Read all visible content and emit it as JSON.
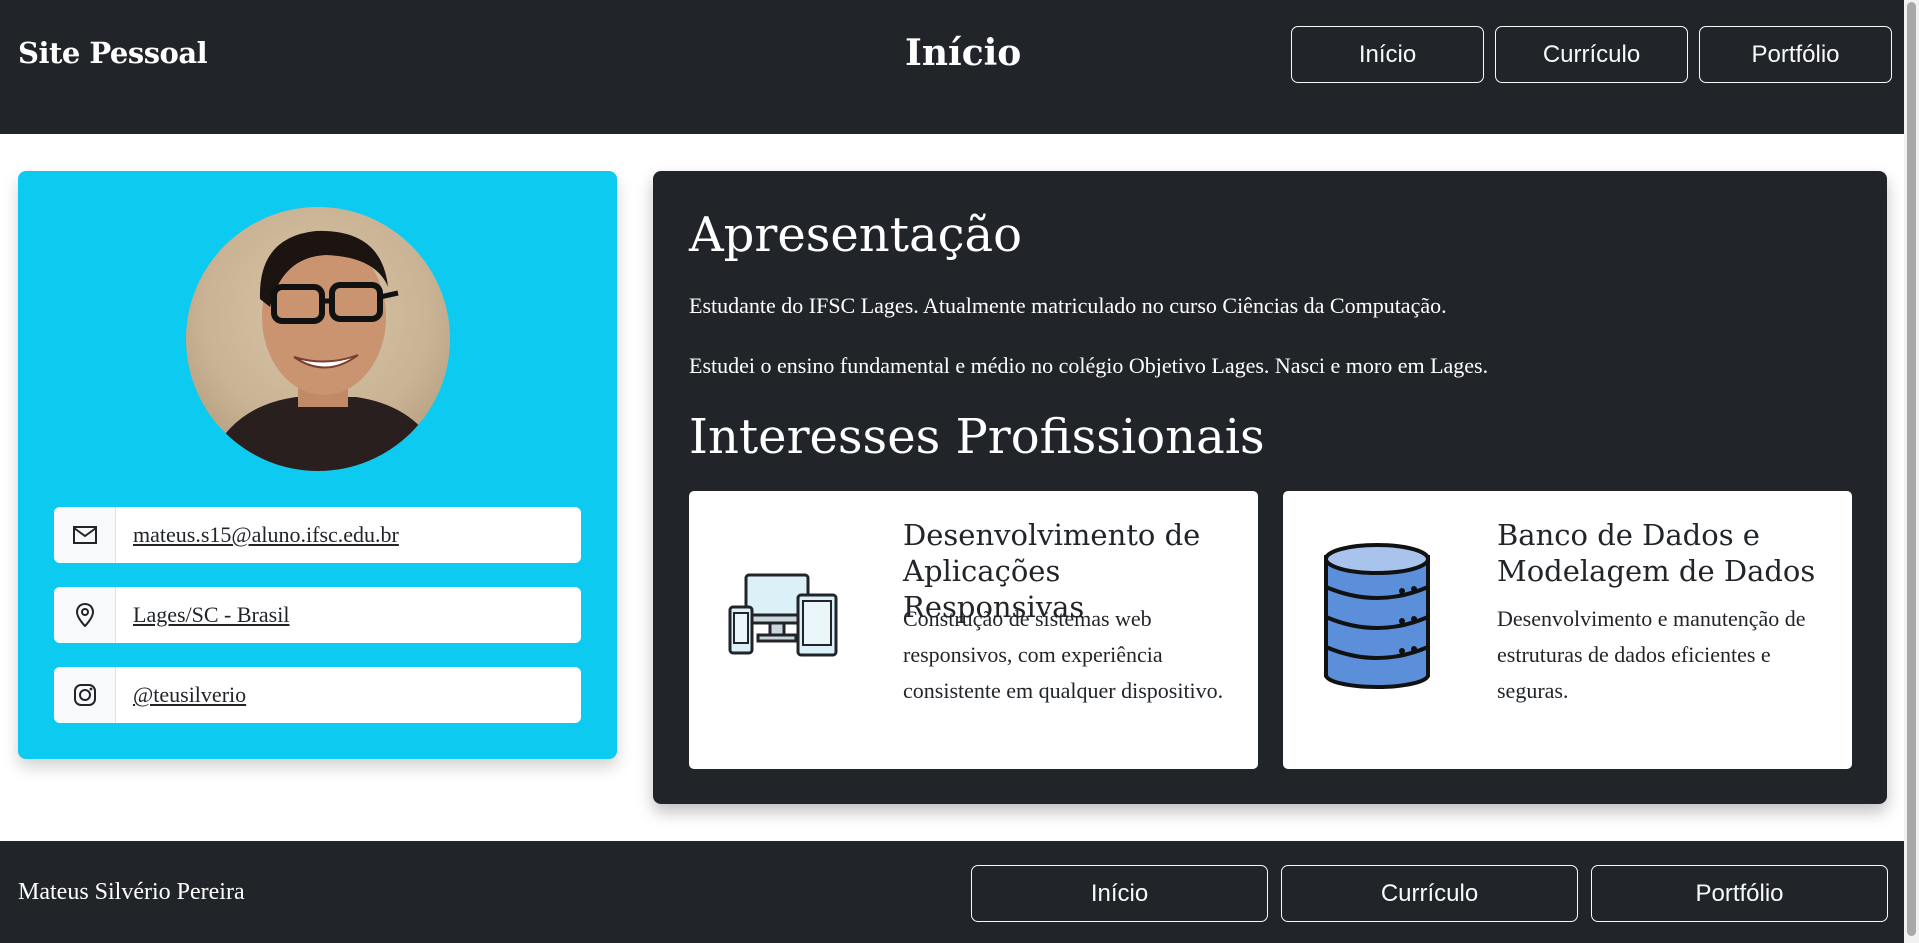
{
  "header": {
    "brand": "Site Pessoal",
    "page_title": "Início",
    "nav": [
      "Início",
      "Currículo",
      "Portfólio"
    ]
  },
  "profile": {
    "contacts": [
      {
        "icon": "envelope-icon",
        "text": "mateus.s15@aluno.ifsc.edu.br"
      },
      {
        "icon": "location-pin-icon",
        "text": "Lages/SC - Brasil"
      },
      {
        "icon": "instagram-icon",
        "text": "@teusilverio"
      }
    ]
  },
  "main": {
    "apresentacao_title": "Apresentação",
    "paragraphs": [
      "Estudante do IFSC Lages. Atualmente matriculado no curso Ciências da Computação.",
      "Estudei o ensino fundamental e médio no colégio Objetivo Lages. Nasci e moro em Lages."
    ],
    "interesses_title": "Interesses Profissionais",
    "interests": [
      {
        "icon": "responsive-devices-icon",
        "title": "Desenvolvimento de Aplicações Responsivas",
        "description": "Construção de sistemas web responsivos, com experiência consistente em qualquer dispositivo."
      },
      {
        "icon": "database-icon",
        "title": "Banco de Dados e Modelagem de Dados",
        "description": "Desenvolvimento e manutenção de estruturas de dados eficientes e seguras."
      }
    ]
  },
  "footer": {
    "author": "Mateus Silvério Pereira",
    "nav": [
      "Início",
      "Currículo",
      "Portfólio"
    ]
  },
  "colors": {
    "dark": "#212529",
    "accent": "#0dcaf0",
    "database_blue": "#5b8fd9"
  }
}
